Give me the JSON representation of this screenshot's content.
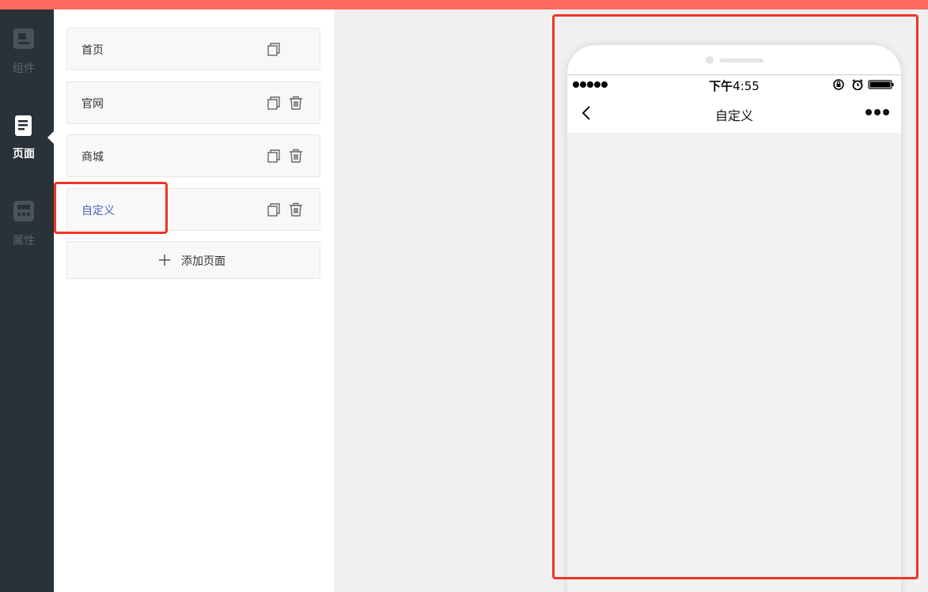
{
  "theme": {
    "topbar_color": "#ff6b5f",
    "nav_bg": "#283238",
    "selected_text": "#4a67b8",
    "highlight": "#f03525"
  },
  "leftnav": {
    "items": [
      {
        "label": "组件",
        "icon": "component-icon",
        "active": false
      },
      {
        "label": "页面",
        "icon": "page-icon",
        "active": true
      },
      {
        "label": "属性",
        "icon": "property-icon",
        "active": false
      }
    ]
  },
  "pages": {
    "items": [
      {
        "label": "首页",
        "deletable": false,
        "selected": false
      },
      {
        "label": "官网",
        "deletable": true,
        "selected": false
      },
      {
        "label": "商城",
        "deletable": true,
        "selected": false
      },
      {
        "label": "自定义",
        "deletable": true,
        "selected": true
      }
    ],
    "add_label": "添加页面"
  },
  "phone": {
    "status_time_prefix": "下午",
    "status_time": "4:55",
    "title": "自定义"
  }
}
